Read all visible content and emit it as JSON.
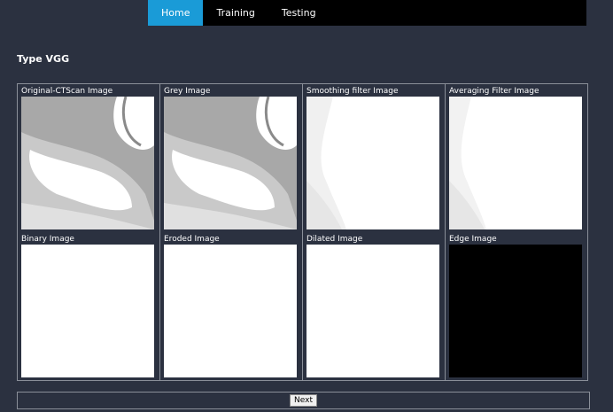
{
  "nav": {
    "items": [
      {
        "label": "Home",
        "active": true
      },
      {
        "label": "Training",
        "active": false
      },
      {
        "label": "Testing",
        "active": false
      }
    ]
  },
  "page": {
    "title": "Type VGG"
  },
  "images": [
    {
      "label": "Original-CTScan Image",
      "style": "ct-scan"
    },
    {
      "label": "Grey Image",
      "style": "ct-scan"
    },
    {
      "label": "Smoothing filter Image",
      "style": "faded"
    },
    {
      "label": "Averaging Filter Image",
      "style": "faded"
    },
    {
      "label": "Binary Image",
      "style": "white"
    },
    {
      "label": "Eroded Image",
      "style": "white"
    },
    {
      "label": "Dilated Image",
      "style": "white"
    },
    {
      "label": "Edge Image",
      "style": "black"
    }
  ],
  "actions": {
    "next_label": "Next"
  },
  "colors": {
    "background": "#2b3140",
    "nav_active": "#1a9bd7",
    "navbar": "#000000"
  }
}
